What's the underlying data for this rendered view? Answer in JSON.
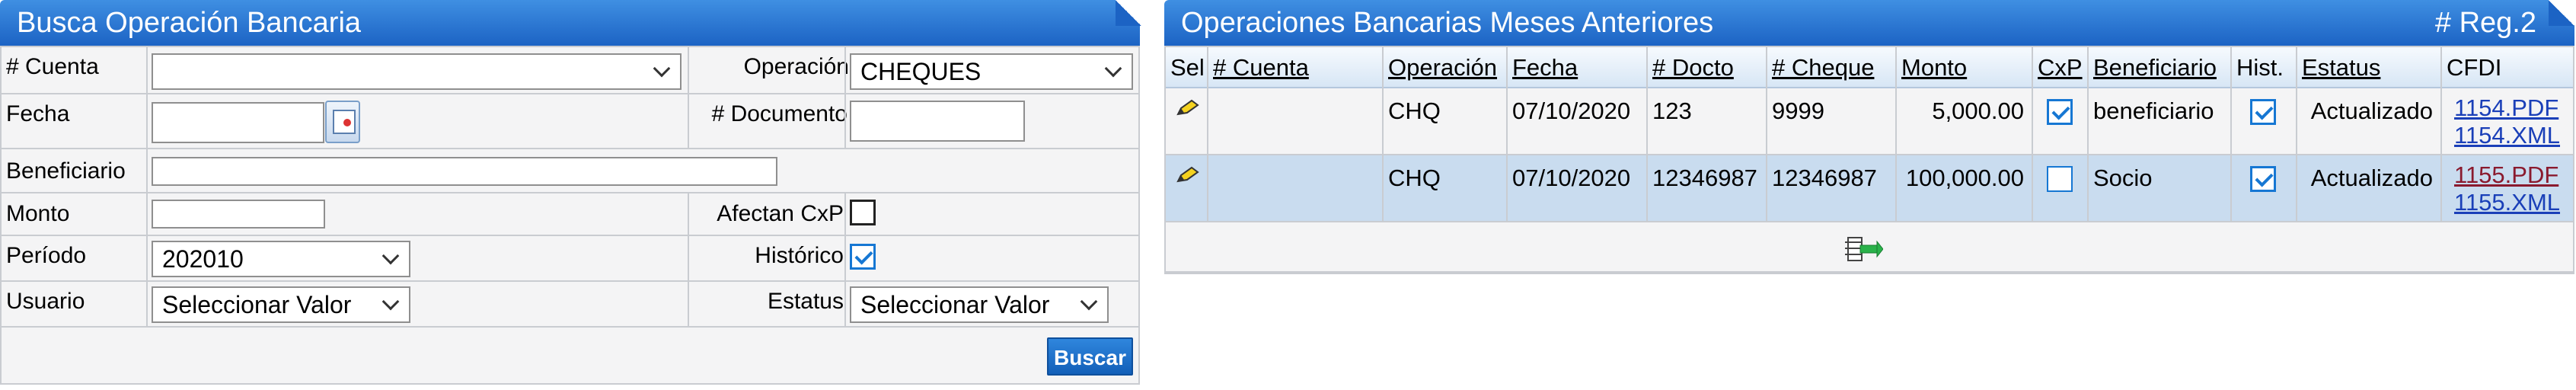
{
  "search": {
    "title": "Busca Operación Bancaria",
    "labels": {
      "cuenta": "# Cuenta",
      "operacion": "Operación",
      "fecha": "Fecha",
      "documento": "# Documento",
      "beneficiario": "Beneficiario",
      "monto": "Monto",
      "afectan": "Afectan CxP",
      "periodo": "Período",
      "historico": "Histórico",
      "usuario": "Usuario",
      "estatus": "Estatus"
    },
    "values": {
      "cuenta": "",
      "operacion": "CHEQUES",
      "fecha": "",
      "documento": "",
      "beneficiario": "",
      "monto": "",
      "afectan_cxp": false,
      "periodo": "202010",
      "historico": true,
      "usuario": "Seleccionar Valor",
      "estatus": "Seleccionar Valor"
    },
    "buscar_label": "Buscar"
  },
  "results": {
    "title": "Operaciones Bancarias Meses Anteriores",
    "reg_count": "# Reg.2",
    "columns": [
      "Sel",
      "# Cuenta",
      "Operación",
      "Fecha",
      "# Docto",
      "# Cheque",
      "Monto",
      "CxP",
      "Beneficiario",
      "Hist.",
      "Estatus",
      "CFDI"
    ],
    "rows": [
      {
        "cuenta": "",
        "operacion": "CHQ",
        "fecha": "07/10/2020",
        "docto": "123",
        "cheque": "9999",
        "monto": "5,000.00",
        "cxp": false,
        "beneficiario": "beneficiario",
        "hist": true,
        "estatus": "Actualizado",
        "pdf": "1154.PDF",
        "xml": "1154.XML"
      },
      {
        "cuenta": "",
        "operacion": "CHQ",
        "fecha": "07/10/2020",
        "docto": "12346987",
        "cheque": "12346987",
        "monto": "100,000.00",
        "cxp": false,
        "beneficiario": "Socio",
        "hist": true,
        "estatus": "Actualizado",
        "pdf": "1155.PDF",
        "xml": "1155.XML"
      }
    ],
    "icons": [
      "pencil-icon",
      "export-excel-icon",
      "calendar-icon",
      "chevron-down-icon",
      "checkmark-icon"
    ],
    "colors": {
      "title_bar": "#1c63c4",
      "selected_row": "#c9dcef",
      "link": "#1a3fb8",
      "visited_link": "#8a1a2e"
    }
  }
}
